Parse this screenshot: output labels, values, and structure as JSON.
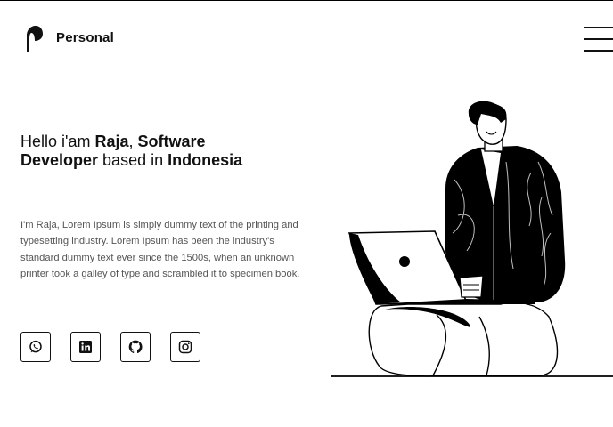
{
  "header": {
    "brand": "Personal",
    "logo_icon": "personal-logo-icon",
    "menu_icon": "hamburger-menu-icon"
  },
  "hero": {
    "greeting": "Hello i'am ",
    "name": "Raja",
    "comma": ", ",
    "role_part1": "Software",
    "role_part2": "Developer",
    "middle": " based in ",
    "location": "Indonesia",
    "description": "I'm Raja, Lorem Ipsum is simply dummy text of the printing and typesetting industry. Lorem Ipsum has been the industry's standard dummy text ever since the 1500s, when an unknown printer took a galley of type and scrambled it to specimen book."
  },
  "socials": [
    {
      "icon": "whatsapp-icon"
    },
    {
      "icon": "linkedin-icon"
    },
    {
      "icon": "github-icon"
    },
    {
      "icon": "instagram-icon"
    }
  ],
  "colors": {
    "text": "#111111",
    "muted": "#555555",
    "background": "#ffffff"
  }
}
